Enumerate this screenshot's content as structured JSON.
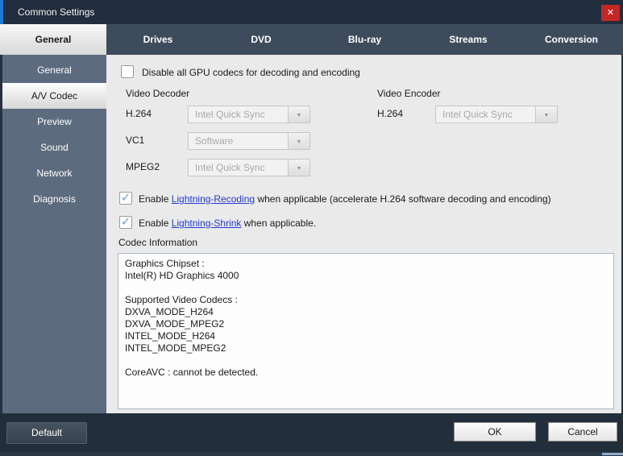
{
  "window": {
    "title": "Common Settings"
  },
  "icons": {
    "close": "✕",
    "check": "✓",
    "dropdown_arrow": "▼"
  },
  "colors": {
    "titlebar": "#222e3e",
    "accent_blue": "#1b7ad2",
    "close_red": "#c42723",
    "tabrow": "#3d4b5c",
    "sidebar": "#5d6b7f",
    "content_bg": "#eaeaea",
    "link_blue": "#2438d2",
    "check_blue": "#7d9cbd",
    "footer": "#232e3c"
  },
  "tabs": [
    {
      "label": "General",
      "selected": true
    },
    {
      "label": "Drives",
      "selected": false
    },
    {
      "label": "DVD",
      "selected": false
    },
    {
      "label": "Blu-ray",
      "selected": false
    },
    {
      "label": "Streams",
      "selected": false
    },
    {
      "label": "Conversion",
      "selected": false
    }
  ],
  "sidebar": {
    "items": [
      {
        "label": "General",
        "selected": false
      },
      {
        "label": "A/V Codec",
        "selected": true
      },
      {
        "label": "Preview",
        "selected": false
      },
      {
        "label": "Sound",
        "selected": false
      },
      {
        "label": "Network",
        "selected": false
      },
      {
        "label": "Diagnosis",
        "selected": false
      }
    ]
  },
  "main": {
    "gpu_checkbox": {
      "label": "Disable all GPU codecs for decoding and encoding",
      "checked": false
    },
    "video_decoder": {
      "title": "Video Decoder",
      "rows": [
        {
          "codec": "H.264",
          "value": "Intel Quick Sync"
        },
        {
          "codec": "VC1",
          "value": "Software"
        },
        {
          "codec": "MPEG2",
          "value": "Intel Quick Sync"
        }
      ]
    },
    "video_encoder": {
      "title": "Video Encoder",
      "rows": [
        {
          "codec": "H.264",
          "value": "Intel Quick Sync"
        }
      ]
    },
    "lightning_recoding": {
      "checked": true,
      "prefix": "Enable ",
      "link": "Lightning-Recoding",
      "suffix": " when applicable (accelerate H.264 software decoding and encoding)"
    },
    "lightning_shrink": {
      "checked": true,
      "prefix": "Enable ",
      "link": "Lightning-Shrink",
      "suffix": " when applicable."
    },
    "codec_information": {
      "title": "Codec Information",
      "text": "Graphics Chipset :\nIntel(R) HD Graphics 4000\n\nSupported Video Codecs :\nDXVA_MODE_H264\nDXVA_MODE_MPEG2\nINTEL_MODE_H264\nINTEL_MODE_MPEG2\n\nCoreAVC : cannot be detected."
    }
  },
  "footer": {
    "default_label": "Default",
    "ok_label": "OK",
    "cancel_label": "Cancel"
  }
}
